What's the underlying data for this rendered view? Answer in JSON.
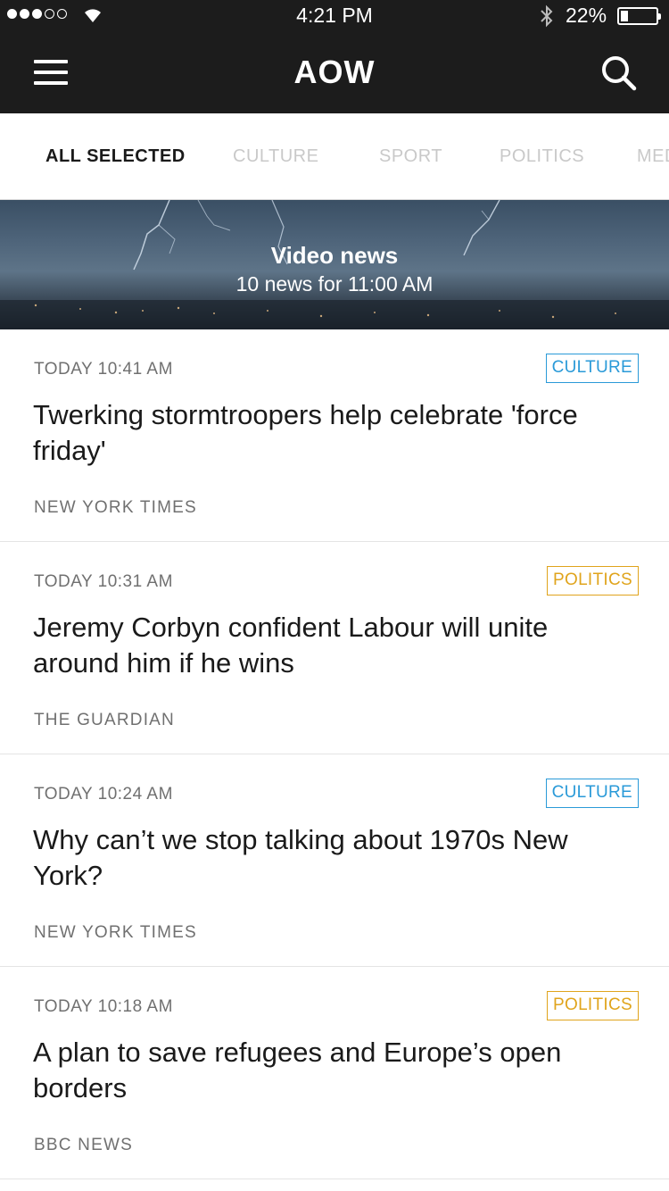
{
  "status_bar": {
    "time": "4:21 PM",
    "battery_pct": "22%",
    "battery_level": 0.22,
    "signal_bars": 3,
    "signal_total": 5
  },
  "header": {
    "title": "AOW",
    "menu_icon": "hamburger-menu-icon",
    "search_icon": "search-icon"
  },
  "tabs": [
    {
      "label": "ALL SELECTED",
      "active": true
    },
    {
      "label": "CULTURE",
      "active": false
    },
    {
      "label": "SPORT",
      "active": false
    },
    {
      "label": "POLITICS",
      "active": false
    },
    {
      "label": "MED",
      "active": false
    }
  ],
  "banner": {
    "title": "Video news",
    "subtitle": "10 news for 11:00 AM"
  },
  "colors": {
    "culture": "#2a9ad8",
    "politics": "#e0a41c",
    "header_bg": "#1c1c1c"
  },
  "news": [
    {
      "time": "TODAY 10:41 AM",
      "category": "CULTURE",
      "title": "Twerking stormtroopers help celebrate 'force friday'",
      "source": "NEW YORK TIMES"
    },
    {
      "time": "TODAY 10:31 AM",
      "category": "POLITICS",
      "title": "Jeremy Corbyn confident Labour will unite around him if he wins",
      "source": "THE GUARDIAN"
    },
    {
      "time": "TODAY 10:24 AM",
      "category": "CULTURE",
      "title": "Why can’t we stop talking about 1970s New York?",
      "source": "NEW YORK TIMES"
    },
    {
      "time": "TODAY 10:18 AM",
      "category": "POLITICS",
      "title": "A plan to save refugees and Europe’s open borders",
      "source": "BBC NEWS"
    }
  ]
}
